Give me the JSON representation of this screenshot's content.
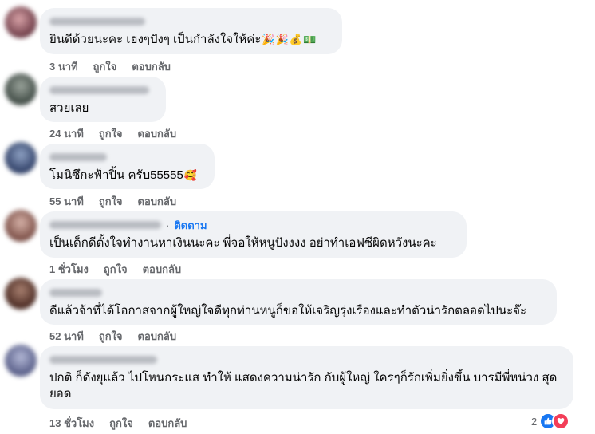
{
  "comments": [
    {
      "text": "ยินดีด้วยนะคะ เฮงๆปังๆ เป็นกำลังใจให้ค่ะ",
      "emojis": [
        "🎉",
        "🎉",
        "💰",
        "💵"
      ],
      "time": "3 นาที",
      "like": "ถูกใจ",
      "reply": "ตอบกลับ"
    },
    {
      "text": "สวยเลย",
      "time": "24 นาที",
      "like": "ถูกใจ",
      "reply": "ตอบกลับ"
    },
    {
      "text": "โมนิซึกะฟ้าปิ้น ครับ55555",
      "emojis": [
        "🥰"
      ],
      "time": "55 นาที",
      "like": "ถูกใจ",
      "reply": "ตอบกลับ"
    },
    {
      "follow": "ติดตาม",
      "text": "เป็นเด็กดีตั้งใจทำงานหาเงินนะคะ พี่จอให้หนูปังงงง อย่าทำเอฟซีผิดหวังนะคะ",
      "time": "1 ชั่วโมง",
      "like": "ถูกใจ",
      "reply": "ตอบกลับ"
    },
    {
      "text": "ดีแล้วจ้าที่ได้โอกาสจากผู้ใหญ่ใจดีทุกท่านหนูก็ขอให้เจริญรุ่งเรืองและทำตัวน่ารักตลอดไปนะจ๊ะ",
      "time": "52 นาที",
      "like": "ถูกใจ",
      "reply": "ตอบกลับ"
    },
    {
      "text": "ปกติ ก็ดังยุแล้ว ไปโหนกระแส ทำให้ แสดงความน่ารัก กับผู้ใหญ่ ใครๆก็รักเพิ่มยิ่งขึ้น บารมีพี่หน่วง สุดยอด",
      "time": "13 ชั่วโมง",
      "like": "ถูกใจ",
      "reply": "ตอบกลับ",
      "reaction_count": "2"
    }
  ],
  "colors": {
    "bubble": "#f0f2f5",
    "meta": "#65676b",
    "link": "#1877f2",
    "like": "#1877f2",
    "love": "#f33e58"
  },
  "icons": {
    "like": "like-reaction-icon",
    "love": "love-reaction-icon"
  }
}
